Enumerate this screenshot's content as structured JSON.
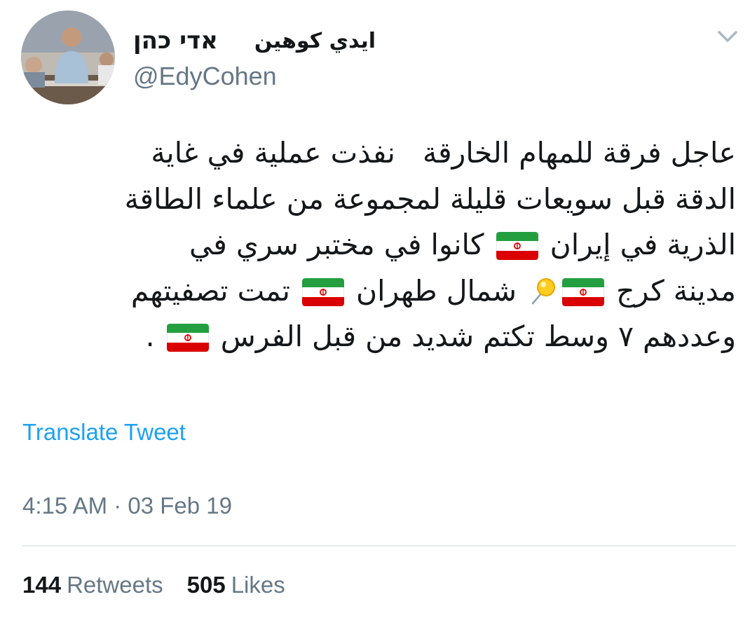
{
  "author": {
    "name_hebrew": "אדי כהן",
    "name_arabic": "ايدي كوهين",
    "handle": "@EdyCohen"
  },
  "tweet": {
    "lines": [
      [
        "عاجل فرقة للمهام الخارقة   نفذت عملية في غاية"
      ],
      [
        "الدقة قبل سويعات قليلة لمجموعة من علماء الطاقة"
      ],
      [
        "الذرية في إيران ",
        "iran-flag-emoji",
        " كانوا في مختبر سري في"
      ],
      [
        "مدينة كرج ",
        "iran-flag-emoji",
        "pushpin-emoji",
        " شمال طهران ",
        "iran-flag-emoji",
        " تمت تصفيتهم"
      ],
      [
        "وعددهم ٧ وسط تكتم شديد من قبل الفرس ",
        "iran-flag-emoji",
        " ."
      ]
    ]
  },
  "translate_label": "Translate Tweet",
  "timestamp": "4:15 AM · 03 Feb 19",
  "stats": {
    "retweets_count": "144",
    "retweets_label": "Retweets",
    "likes_count": "505",
    "likes_label": "Likes"
  },
  "colors": {
    "link_blue": "#1da1f2",
    "secondary_gray": "#657786",
    "divider": "#e6ecf0",
    "text": "#14171a"
  },
  "icons": {
    "menu": "chevron-down-icon"
  }
}
